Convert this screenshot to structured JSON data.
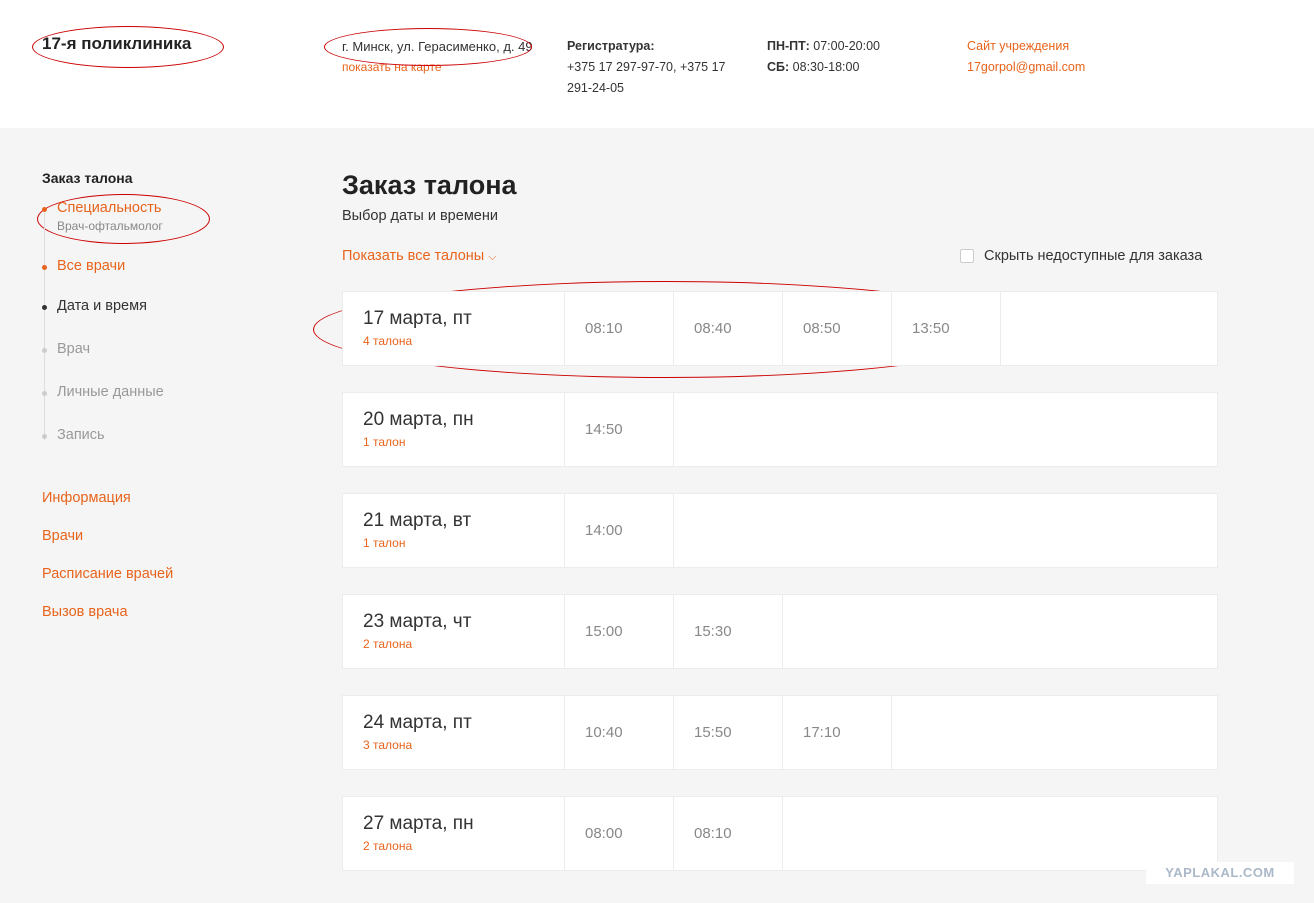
{
  "header": {
    "clinic_name": "17-я поликлиника",
    "address": "г. Минск, ул. Герасименко, д. 49",
    "map_link": "показать на карте",
    "registry_label": "Регистратура:",
    "registry_phones": "+375 17 297-97-70, +375 17 291-24-05",
    "weekdays_label": "ПН-ПТ:",
    "weekdays_hours": "07:00-20:00",
    "sat_label": "СБ:",
    "sat_hours": "08:30-18:00",
    "site_link": "Сайт учреждения",
    "email": "17gorpol@gmail.com"
  },
  "sidebar": {
    "title": "Заказ талона",
    "steps": [
      {
        "label": "Специальность",
        "sub": "Врач-офтальмолог"
      },
      {
        "label": "Все врачи"
      },
      {
        "label": "Дата и время"
      },
      {
        "label": "Врач"
      },
      {
        "label": "Личные данные"
      },
      {
        "label": "Запись"
      }
    ],
    "links": [
      "Информация",
      "Врачи",
      "Расписание врачей",
      "Вызов врача"
    ]
  },
  "main": {
    "title": "Заказ талона",
    "subtitle": "Выбор даты и времени",
    "show_all": "Показать все талоны",
    "hide_unavailable": "Скрыть недоступные для заказа",
    "days": [
      {
        "date": "17 марта, пт",
        "count": "4 талона",
        "slots": [
          "08:10",
          "08:40",
          "08:50",
          "13:50"
        ]
      },
      {
        "date": "20 марта, пн",
        "count": "1 талон",
        "slots": [
          "14:50"
        ]
      },
      {
        "date": "21 марта, вт",
        "count": "1 талон",
        "slots": [
          "14:00"
        ]
      },
      {
        "date": "23 марта, чт",
        "count": "2 талона",
        "slots": [
          "15:00",
          "15:30"
        ]
      },
      {
        "date": "24 марта, пт",
        "count": "3 талона",
        "slots": [
          "10:40",
          "15:50",
          "17:10"
        ]
      },
      {
        "date": "27 марта, пн",
        "count": "2 талона",
        "slots": [
          "08:00",
          "08:10"
        ]
      }
    ]
  },
  "watermark": "YAPLAKAL.COM",
  "colors": {
    "accent": "#e8641c",
    "annotation": "#cc0000"
  }
}
